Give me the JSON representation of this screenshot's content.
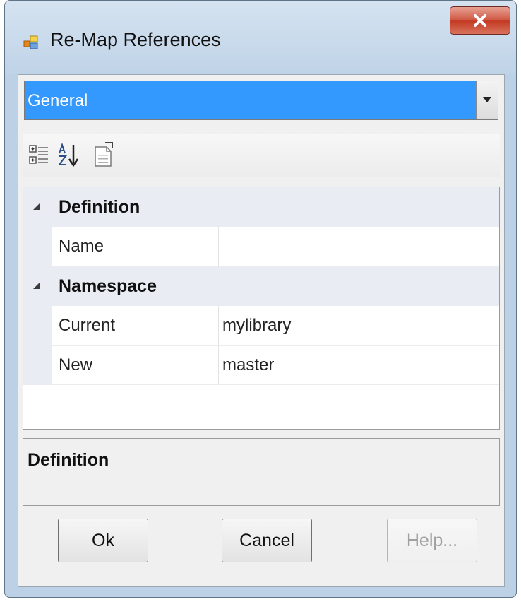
{
  "window": {
    "title": "Re-Map References",
    "close_icon": "close-icon"
  },
  "selector": {
    "value": "General"
  },
  "toolbar": {
    "icons": [
      "categorized-view-icon",
      "alphabetical-sort-icon",
      "property-pages-icon"
    ]
  },
  "grid": {
    "categories": [
      {
        "label": "Definition",
        "properties": [
          {
            "name": "Name",
            "value": ""
          }
        ]
      },
      {
        "label": "Namespace",
        "properties": [
          {
            "name": "Current",
            "value": "mylibrary"
          },
          {
            "name": "New",
            "value": "master"
          }
        ]
      }
    ]
  },
  "description": {
    "title": "Definition"
  },
  "buttons": {
    "ok": "Ok",
    "cancel": "Cancel",
    "help": "Help..."
  },
  "colors": {
    "selection": "#3399ff",
    "frame": "#bcd1e6",
    "close": "#c33a22"
  }
}
